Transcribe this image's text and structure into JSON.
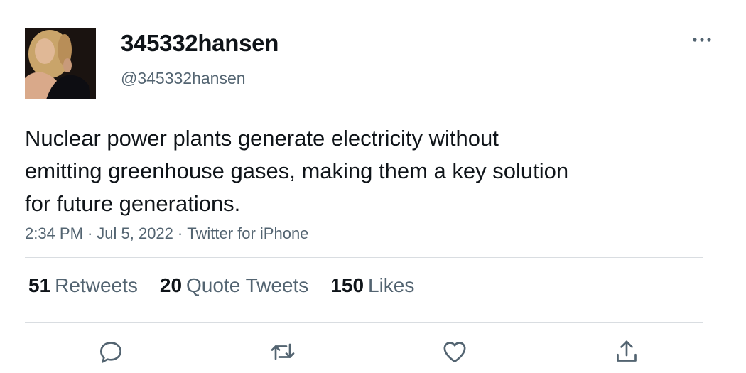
{
  "author": {
    "display_name": "345332hansen",
    "handle": "@345332hansen",
    "avatar": "profile-photo"
  },
  "tweet": {
    "text": "Nuclear power plants generate electricity without\nemitting greenhouse gases, making them a key solution\nfor future generations.",
    "time": "2:34 PM",
    "date": "Jul 5, 2022",
    "source": "Twitter for iPhone",
    "separator": "·"
  },
  "stats": {
    "retweets": {
      "count": "51",
      "label": "Retweets"
    },
    "quotes": {
      "count": "20",
      "label": "Quote Tweets"
    },
    "likes": {
      "count": "150",
      "label": "Likes"
    }
  },
  "actions": [
    {
      "icon": "reply-icon"
    },
    {
      "icon": "retweet-icon"
    },
    {
      "icon": "like-icon"
    },
    {
      "icon": "share-icon"
    }
  ],
  "colors": {
    "text_primary": "#0f1419",
    "text_secondary": "#536471",
    "divider": "#d9dde1",
    "icon": "#536471"
  }
}
